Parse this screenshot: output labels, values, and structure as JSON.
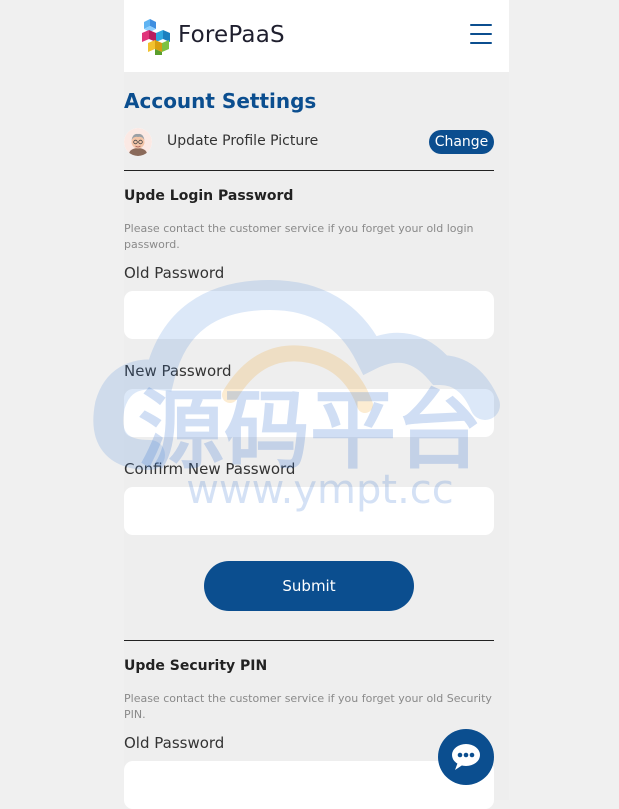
{
  "header": {
    "brand": "ForePaaS",
    "menu_icon": "hamburger-icon",
    "logo_icon": "forepaas-cubes-logo"
  },
  "colors": {
    "accent": "#0b4e8f",
    "background": "#eeeeee",
    "header_bg": "#ffffff",
    "hint_text": "#8a8a8a"
  },
  "page": {
    "title": "Account Settings"
  },
  "profile": {
    "label": "Update Profile Picture",
    "change_label": "Change",
    "avatar_icon": "avatar-icon"
  },
  "login_password": {
    "title": "Upde Login Password",
    "hint": "Please contact the customer service if you forget your old login password.",
    "old_label": "Old Password",
    "old_value": "",
    "new_label": "New Password",
    "new_value": "",
    "confirm_label": "Confirm New Password",
    "confirm_value": "",
    "submit_label": "Submit"
  },
  "security_pin": {
    "title": "Upde Security PIN",
    "hint": "Please contact the customer service if you forget your old Security PIN.",
    "old_label": "Old Password",
    "old_value": ""
  },
  "watermark": {
    "cn_text": "源码平台",
    "url_text": "www.ympt.cc"
  },
  "chat": {
    "icon": "chat-bubble-icon"
  }
}
